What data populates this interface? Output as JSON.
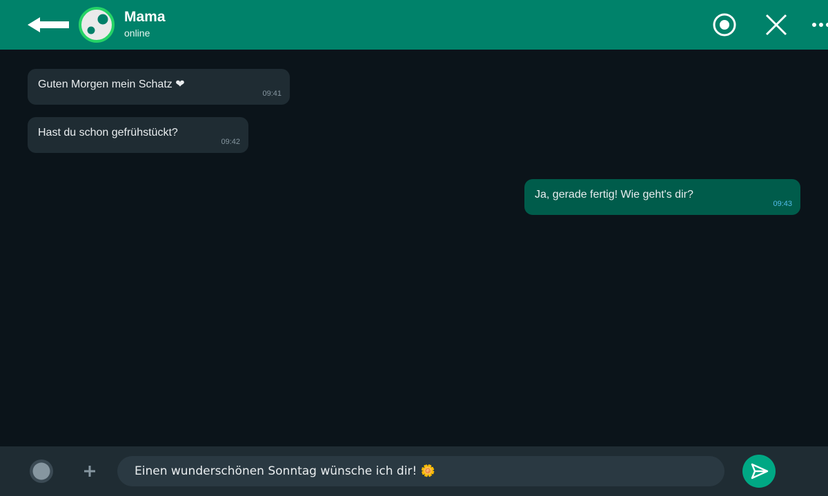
{
  "header": {
    "contact_name": "Mama",
    "contact_status": "online",
    "icons": {
      "back": "arrow-left-icon",
      "avatar": "avatar",
      "record": "record-icon",
      "close": "close-icon",
      "more": "more-dots-icon"
    }
  },
  "messages": [
    {
      "direction": "incoming",
      "text": "Guten Morgen mein Schatz ❤",
      "time": "09:41"
    },
    {
      "direction": "incoming",
      "text": "Hast du schon gefrühstückt?",
      "time": "09:42"
    },
    {
      "direction": "outgoing",
      "text": "Ja, gerade fertig! Wie geht's dir?",
      "time": "09:43"
    }
  ],
  "composer": {
    "value": "Einen wunderschönen Sonntag wünsche ich dir! 🌼",
    "icons": {
      "emoji": "emoji-icon",
      "attach": "plus-icon",
      "send": "send-icon"
    }
  },
  "colors": {
    "header": "#00826a",
    "background": "#0b141a",
    "incoming_bubble": "#1f2c33",
    "outgoing_bubble": "#005c4b",
    "send_button": "#00a884",
    "outgoing_time": "#53bdeb"
  }
}
